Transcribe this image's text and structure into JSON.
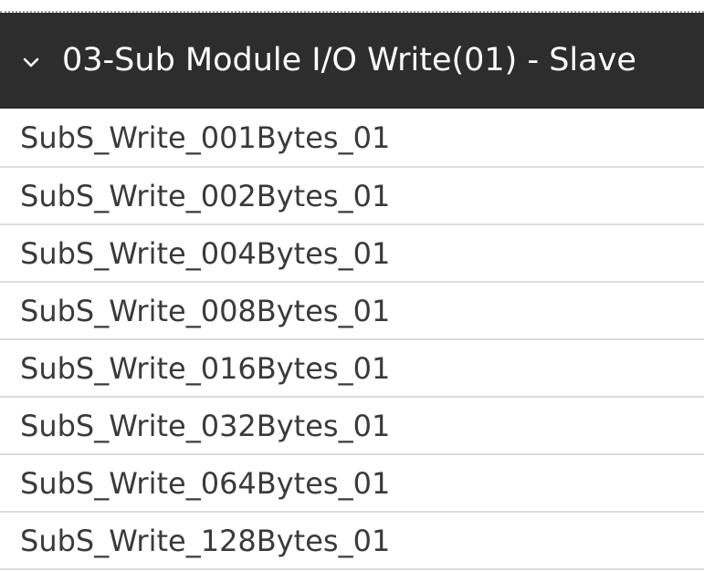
{
  "group": {
    "title": "03-Sub Module I/O Write(01) - Slave",
    "expanded_icon": "chevron-down-icon",
    "header_bg": "#2d2d2d",
    "header_text_color": "#ffffff"
  },
  "items": [
    {
      "label": "SubS_Write_001Bytes_01"
    },
    {
      "label": "SubS_Write_002Bytes_01"
    },
    {
      "label": "SubS_Write_004Bytes_01"
    },
    {
      "label": "SubS_Write_008Bytes_01"
    },
    {
      "label": "SubS_Write_016Bytes_01"
    },
    {
      "label": "SubS_Write_032Bytes_01"
    },
    {
      "label": "SubS_Write_064Bytes_01"
    },
    {
      "label": "SubS_Write_128Bytes_01"
    }
  ]
}
